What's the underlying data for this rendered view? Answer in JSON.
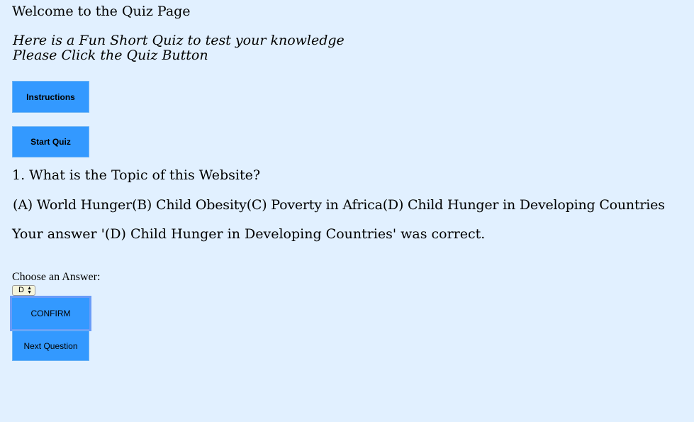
{
  "page": {
    "welcome": "Welcome to the Quiz Page",
    "subtitle_line1": "Here is a Fun Short Quiz to test your knowledge",
    "subtitle_line2": "Please Click the Quiz Button"
  },
  "buttons": {
    "instructions": "Instructions",
    "start_quiz": "Start Quiz",
    "confirm": "CONFIRM",
    "next_question": "Next Question"
  },
  "quiz": {
    "question": "1. What is the Topic of this Website?",
    "options": "(A) World Hunger(B) Child Obesity(C) Poverty in Africa(D) Child Hunger in Developing Countries",
    "result": "Your answer '(D) Child Hunger in Developing Countries' was correct.",
    "choose_label": "Choose an Answer:",
    "selected_answer": "D"
  },
  "icons": {
    "select_arrows": "up-down-arrows-icon"
  },
  "colors": {
    "background": "#e1f0ff",
    "button": "#3399ff",
    "focus_outline": "#6a9cf8"
  }
}
